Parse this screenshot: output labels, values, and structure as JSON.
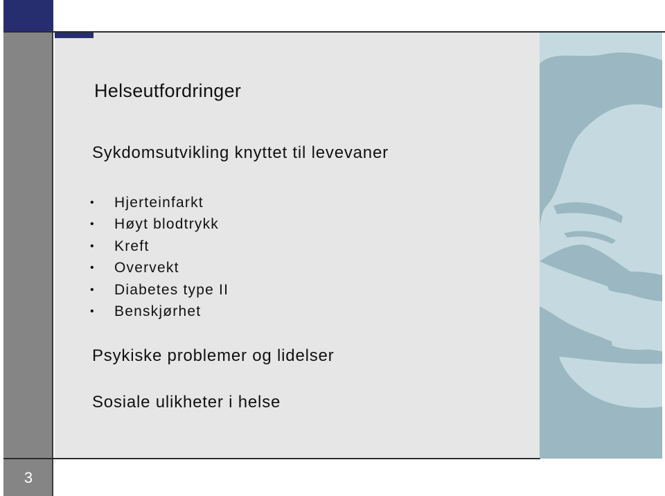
{
  "slide": {
    "title": "Helseutfordringer",
    "page_number": "3",
    "sections": [
      {
        "heading": "Sykdomsutvikling knyttet til levevaner",
        "bullet_glyph": "•",
        "items": [
          "Hjerteinfarkt",
          "Høyt blodtrykk",
          "Kreft",
          "Overvekt",
          "Diabetes type II",
          "Benskjørhet"
        ]
      },
      {
        "heading": "Psykiske problemer og lidelser"
      },
      {
        "heading": "Sosiale ulikheter i helse"
      }
    ],
    "image": {
      "description": "stylized duotone photo of a smiling man's face"
    }
  },
  "colors": {
    "brand_navy": "#262e70",
    "sidebar_gray": "#858585",
    "content_bg": "#e6e6e6",
    "photo_dark": "#9ab7c2",
    "photo_light": "#c5dae0"
  }
}
